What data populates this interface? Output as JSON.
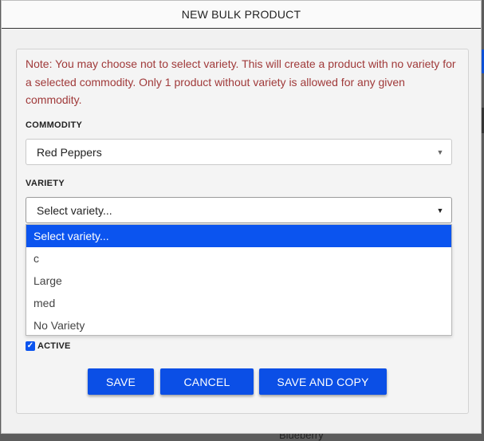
{
  "background": {
    "partial_text": "Blueberry"
  },
  "modal": {
    "title": "NEW BULK PRODUCT",
    "note": "Note: You may choose not to select variety. This will create a product with no variety for a selected commodity. Only 1 product without variety is allowed for any given commodity.",
    "commodity": {
      "label": "COMMODITY",
      "value": "Red Peppers",
      "arrow": "▼"
    },
    "variety": {
      "label": "VARIETY",
      "value": "Select variety...",
      "arrow": "▼",
      "options": [
        "Select variety...",
        "c",
        "Large",
        "med",
        "No Variety"
      ]
    },
    "active": {
      "label": "ACTIVE",
      "checked": true,
      "check_glyph": "✓"
    },
    "buttons": {
      "save": "SAVE",
      "cancel": "CANCEL",
      "save_and_copy": "SAVE AND COPY"
    }
  },
  "colors": {
    "accent": "#0b4fe6",
    "note_text": "#a03a3a",
    "selected_option": "#0b54ef"
  }
}
